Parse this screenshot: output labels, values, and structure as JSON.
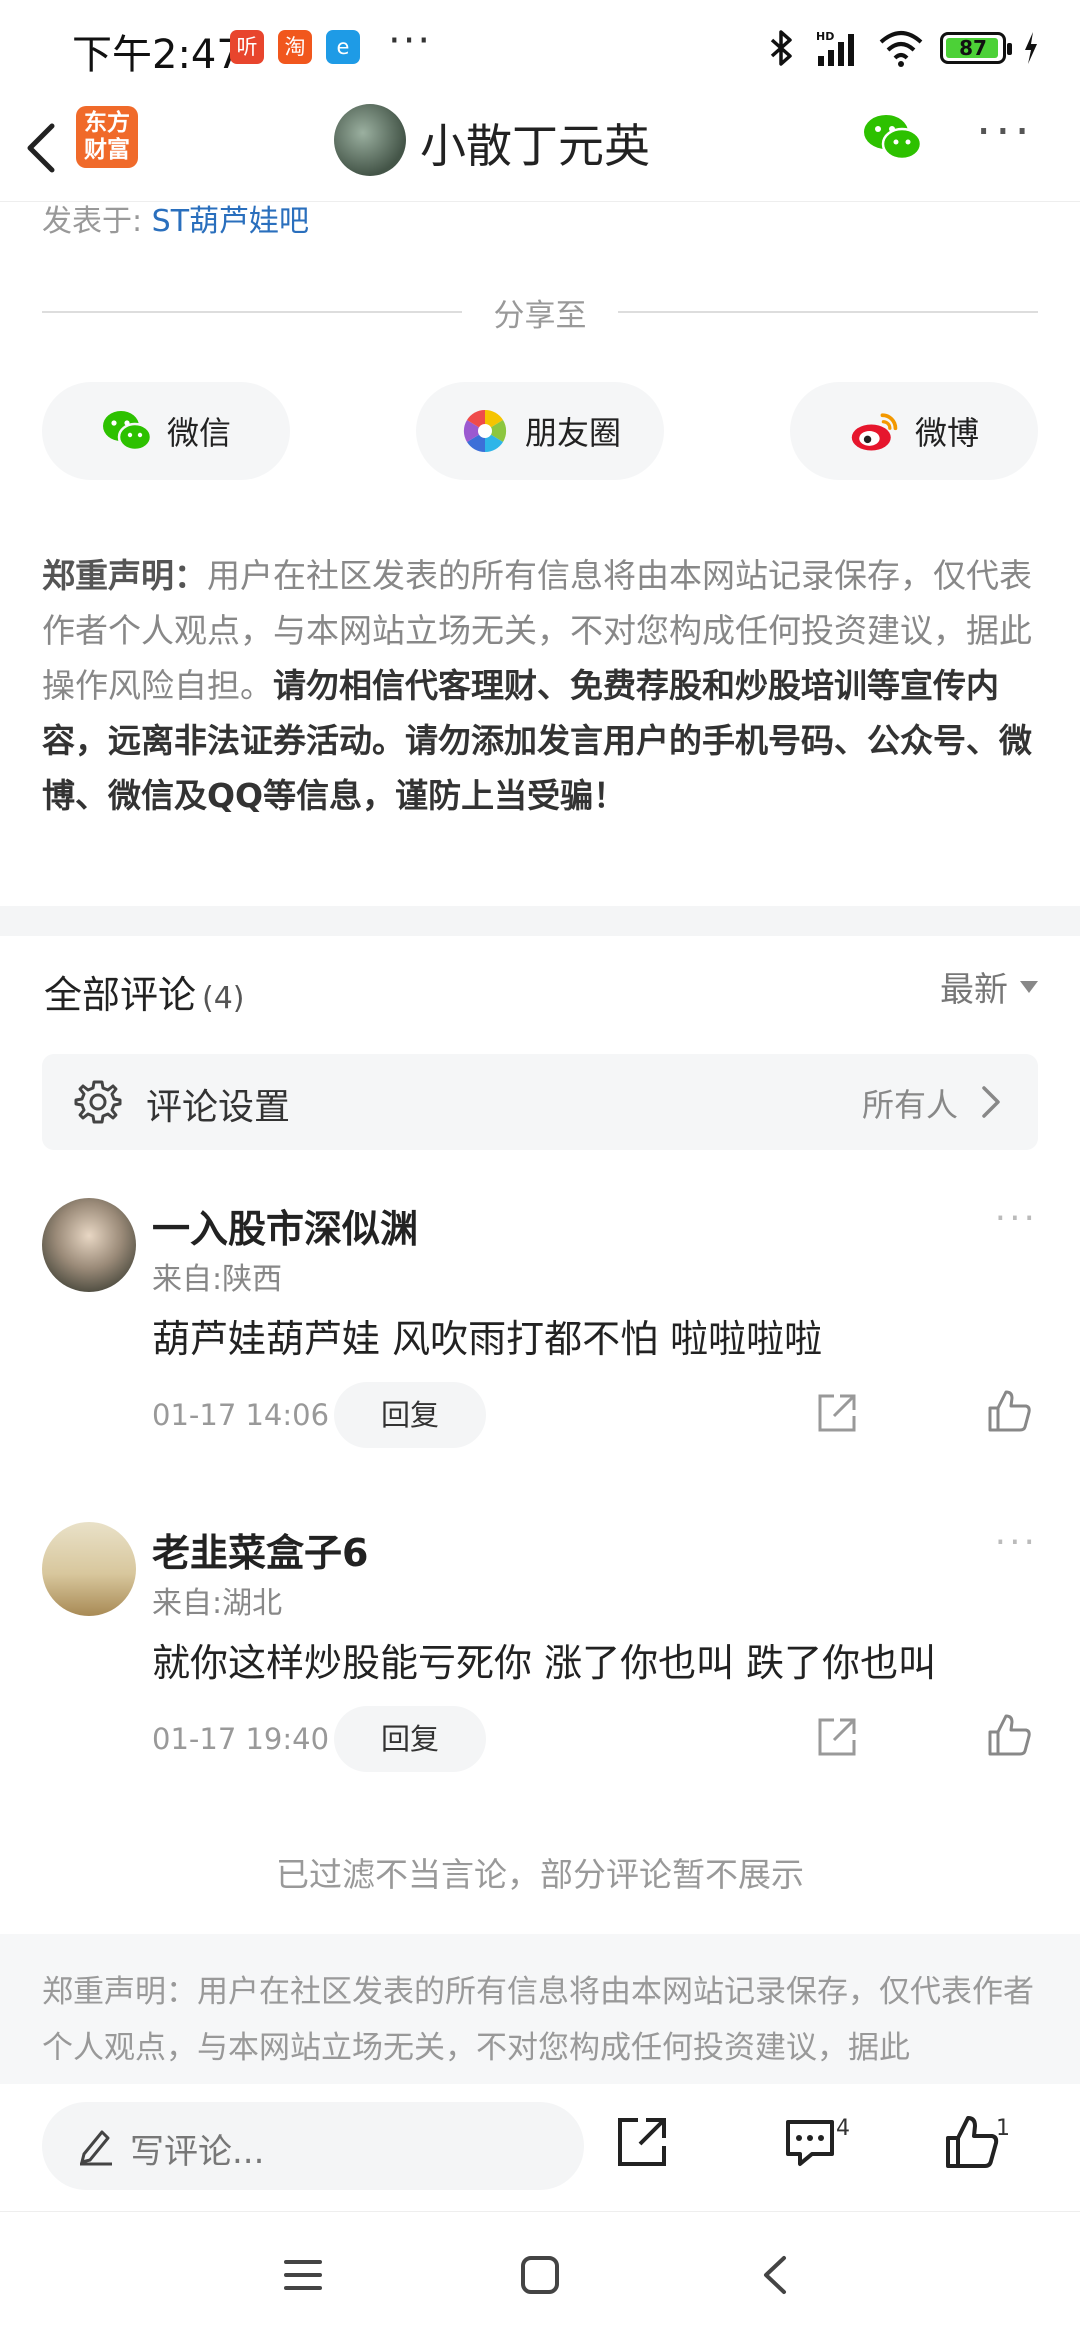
{
  "status_bar": {
    "time": "下午2:47",
    "app_icons": [
      {
        "name": "ting-app-icon",
        "glyph": "听",
        "color": "#e8452d"
      },
      {
        "name": "taobao-app-icon",
        "glyph": "淘",
        "color": "#f1571d"
      },
      {
        "name": "browser-app-icon",
        "glyph": "e",
        "color": "#1e9be6"
      }
    ],
    "dots": "···",
    "battery": "87"
  },
  "header": {
    "logo": "东方财富",
    "title": "小散丁元英"
  },
  "post": {
    "posted_in_label": "发表于:",
    "posted_in_value": "ST葫芦娃吧"
  },
  "share": {
    "label": "分享至",
    "buttons": [
      {
        "label": "微信",
        "icon": "wechat-icon"
      },
      {
        "label": "朋友圈",
        "icon": "moments-icon"
      },
      {
        "label": "微博",
        "icon": "weibo-icon"
      }
    ]
  },
  "disclaimer": {
    "title": "郑重声明：",
    "normal": "用户在社区发表的所有信息将由本网站记录保存，仅代表作者个人观点，与本网站立场无关，不对您构成任何投资建议，据此操作风险自担。",
    "strong": "请勿相信代客理财、免费荐股和炒股培训等宣传内容，远离非法证券活动。请勿添加发言用户的手机号码、公众号、微博、微信及QQ等信息，谨防上当受骗！"
  },
  "comments": {
    "title": "全部评论",
    "count": "(4)",
    "sort": "最新",
    "settings_label": "评论设置",
    "settings_value": "所有人",
    "items": [
      {
        "name": "一入股市深似渊",
        "location": "来自:陕西",
        "text": "葫芦娃葫芦娃  风吹雨打都不怕  啦啦啦啦",
        "time": "01-17 14:06",
        "reply": "回复"
      },
      {
        "name": "老韭菜盒子6",
        "location": "来自:湖北",
        "text": "就你这样炒股能亏死你 涨了你也叫 跌了你也叫",
        "time": "01-17 19:40",
        "reply": "回复"
      }
    ],
    "filtered_note": "已过滤不当言论，部分评论暂不展示"
  },
  "footer_disclaimer": "郑重声明：用户在社区发表的所有信息将由本网站记录保存，仅代表作者个人观点，与本网站立场无关，不对您构成任何投资建议，据此",
  "bottom_bar": {
    "placeholder": "写评论...",
    "comment_count": "4",
    "like_count": "1"
  },
  "colors": {
    "accent_link": "#2a6fbd",
    "logo": "#f06a2a",
    "wechat_green": "#2dc100",
    "battery_green": "#4cd137"
  }
}
